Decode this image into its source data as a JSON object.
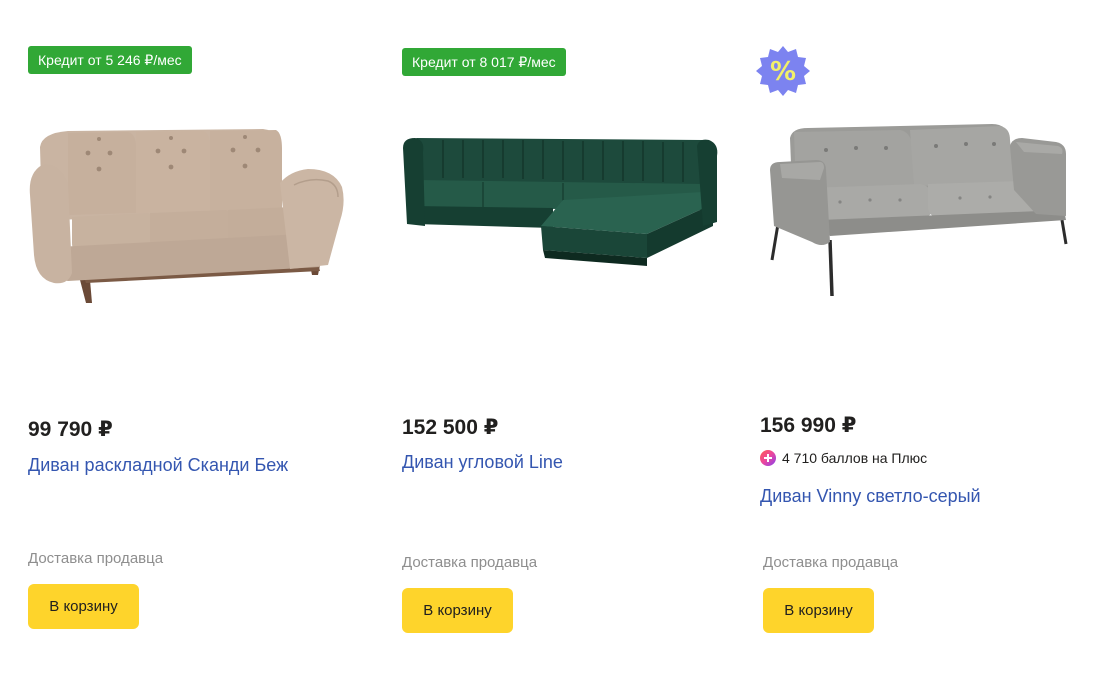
{
  "products": [
    {
      "credit_badge": "Кредит от 5 246 ₽/мес",
      "price": "99 790 ₽",
      "title": "Диван раскладной Сканди Беж",
      "delivery": "Доставка продавца",
      "cart_button": "В корзину",
      "image_icon": "beige-sofa-photo"
    },
    {
      "credit_badge": "Кредит от 8 017 ₽/мес",
      "price": "152 500 ₽",
      "title": "Диван угловой Line",
      "delivery": "Доставка продавца",
      "cart_button": "В корзину",
      "image_icon": "green-corner-sofa-photo"
    },
    {
      "discount_icon": "percent-discount-icon",
      "price": "156 990 ₽",
      "plus_points": "4 710 баллов на Плюс",
      "title": "Диван Vinny светло-серый",
      "delivery": "Доставка продавца",
      "cart_button": "В корзину",
      "image_icon": "grey-sofa-photo"
    }
  ],
  "colors": {
    "credit_badge": "#31a836",
    "cart_button": "#fed42b",
    "title_link": "#3456b0",
    "delivery_text": "#8e8e8e"
  }
}
